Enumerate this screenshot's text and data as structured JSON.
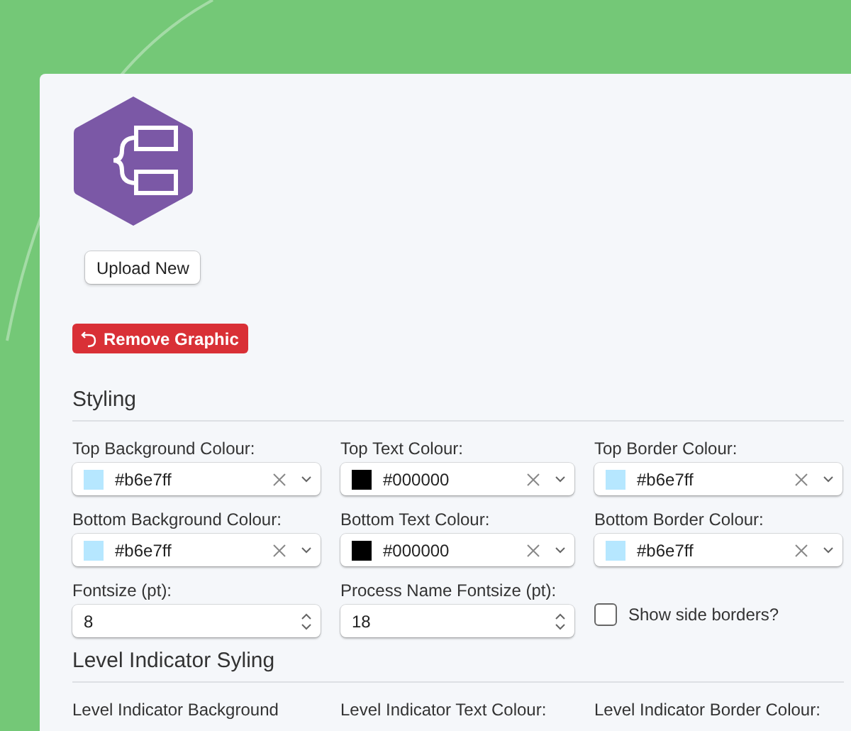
{
  "upload_button": "Upload New",
  "remove_button": "Remove Graphic",
  "sections": [
    {
      "title": "Styling",
      "fields": [
        {
          "kind": "colour",
          "label": "Top Background Colour:",
          "value": "#b6e7ff",
          "color": "#b6e7ff"
        },
        {
          "kind": "colour",
          "label": "Top Text Colour:",
          "value": "#000000",
          "color": "#000000"
        },
        {
          "kind": "colour",
          "label": "Top Border Colour:",
          "value": "#b6e7ff",
          "color": "#b6e7ff"
        },
        {
          "kind": "colour",
          "label": "Bottom Background Colour:",
          "value": "#b6e7ff",
          "color": "#b6e7ff"
        },
        {
          "kind": "colour",
          "label": "Bottom Text Colour:",
          "value": "#000000",
          "color": "#000000"
        },
        {
          "kind": "colour",
          "label": "Bottom Border Colour:",
          "value": "#b6e7ff",
          "color": "#b6e7ff"
        },
        {
          "kind": "number",
          "label": "Fontsize (pt):",
          "value": "8"
        },
        {
          "kind": "number",
          "label": "Process Name Fontsize (pt):",
          "value": "18"
        },
        {
          "kind": "checkbox",
          "label": "Show side borders?",
          "checked": false
        }
      ]
    },
    {
      "title": "Level Indicator Syling",
      "fields": [
        {
          "kind": "label",
          "label": "Level Indicator Background"
        },
        {
          "kind": "label",
          "label": "Level Indicator Text Colour:"
        },
        {
          "kind": "label",
          "label": "Level Indicator Border Colour:"
        }
      ]
    }
  ]
}
